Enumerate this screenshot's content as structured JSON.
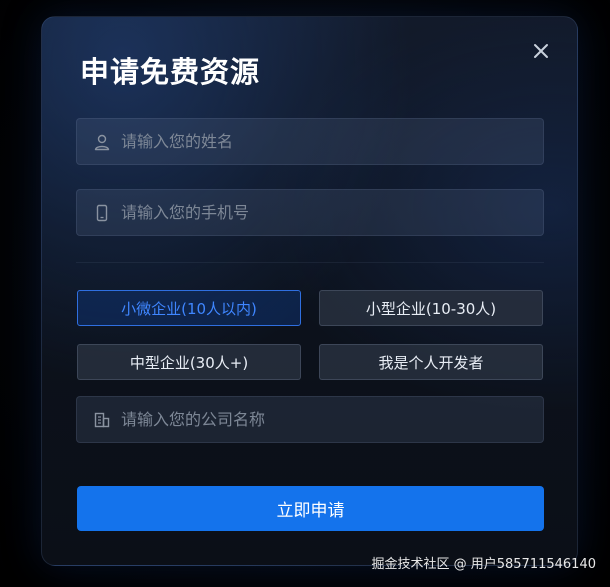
{
  "modal": {
    "title": "申请免费资源",
    "close_icon": "close-icon"
  },
  "form": {
    "name_placeholder": "请输入您的姓名",
    "name_icon": "user-icon",
    "phone_placeholder": "请输入您的手机号",
    "phone_icon": "mobile-phone-icon",
    "company_placeholder": "请输入您的公司名称",
    "company_icon": "building-icon",
    "options": [
      {
        "label": "小微企业(10人以内)",
        "selected": true
      },
      {
        "label": "小型企业(10-30人)",
        "selected": false
      },
      {
        "label": "中型企业(30人+)",
        "selected": false
      },
      {
        "label": "我是个人开发者",
        "selected": false
      }
    ],
    "submit_label": "立即申请"
  },
  "colors": {
    "accent": "#1473ec",
    "selected_text": "#3f86ff"
  },
  "watermark": "掘金技术社区 @ 用户585711546140"
}
